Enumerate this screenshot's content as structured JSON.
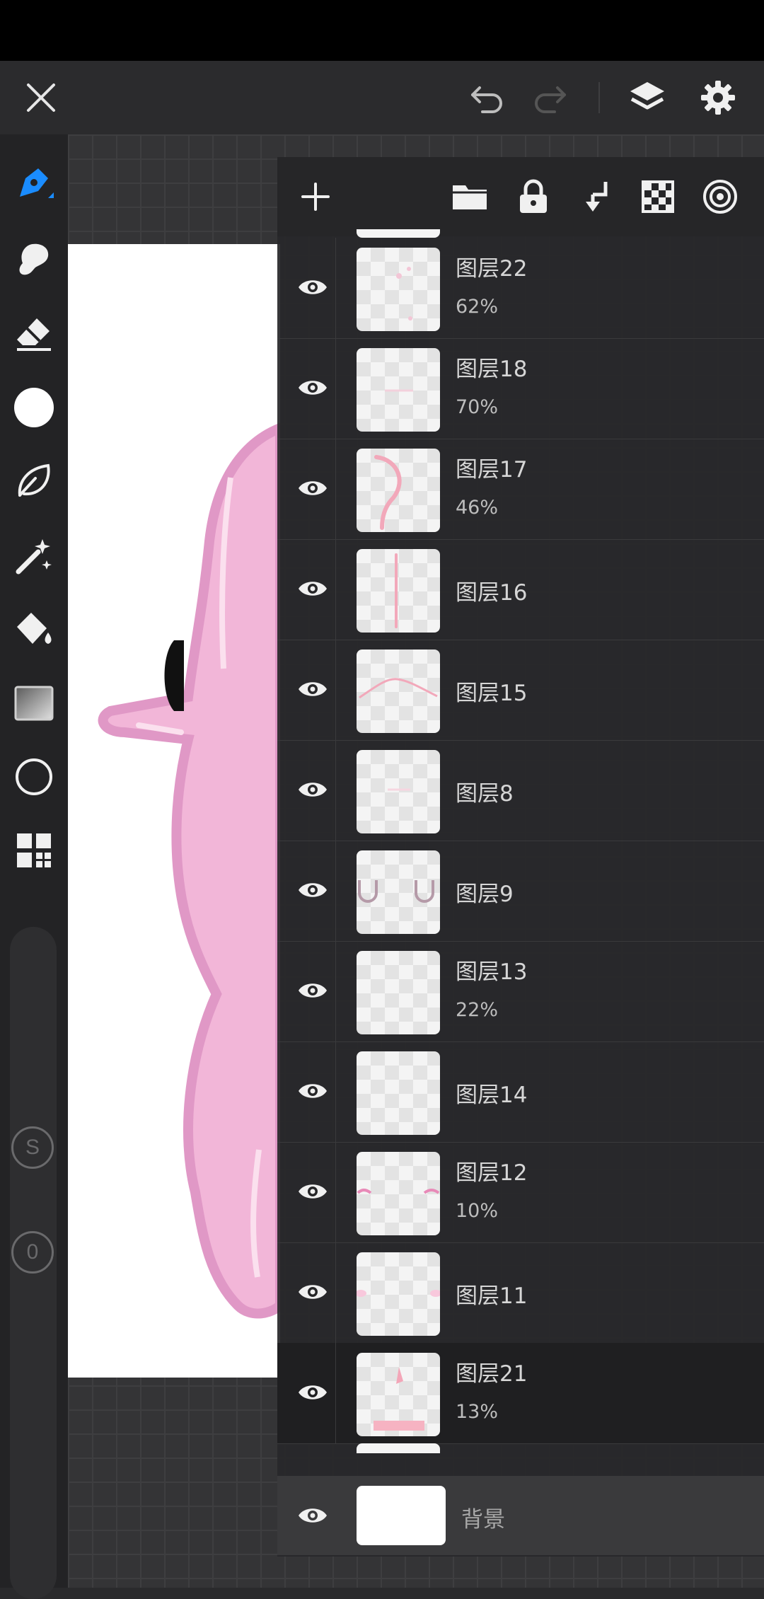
{
  "topbar": {
    "close_icon": "close-icon",
    "undo_icon": "undo-icon",
    "redo_icon": "redo-icon",
    "layers_icon": "layers-icon",
    "settings_icon": "gear-icon"
  },
  "toolbar": {
    "tools": [
      "brush-icon",
      "smudge-icon",
      "eraser-icon",
      "color-swatch",
      "lasso-icon",
      "magic-wand-icon",
      "fill-bucket-icon",
      "gradient-icon",
      "shape-circle-icon",
      "grid-icon"
    ],
    "stabilizer_label": "S",
    "opacity_label": "0",
    "active_color": "#ffffff"
  },
  "layers_panel": {
    "header_icons": [
      "add-icon",
      "folder-icon",
      "lock-icon",
      "merge-down-icon",
      "checker-icon",
      "blend-mode-icon"
    ],
    "layers": [
      {
        "name": "图层22",
        "opacity": "62%"
      },
      {
        "name": "图层18",
        "opacity": "70%"
      },
      {
        "name": "图层17",
        "opacity": "46%"
      },
      {
        "name": "图层16",
        "opacity": ""
      },
      {
        "name": "图层15",
        "opacity": ""
      },
      {
        "name": "图层8",
        "opacity": ""
      },
      {
        "name": "图层9",
        "opacity": ""
      },
      {
        "name": "图层13",
        "opacity": "22%"
      },
      {
        "name": "图层14",
        "opacity": ""
      },
      {
        "name": "图层12",
        "opacity": "10%"
      },
      {
        "name": "图层11",
        "opacity": ""
      },
      {
        "name": "图层21",
        "opacity": "13%"
      }
    ],
    "background_layer": {
      "name": "背景"
    }
  },
  "colors": {
    "accent": "#1a8cff",
    "character_pink": "#f2b6d8"
  }
}
